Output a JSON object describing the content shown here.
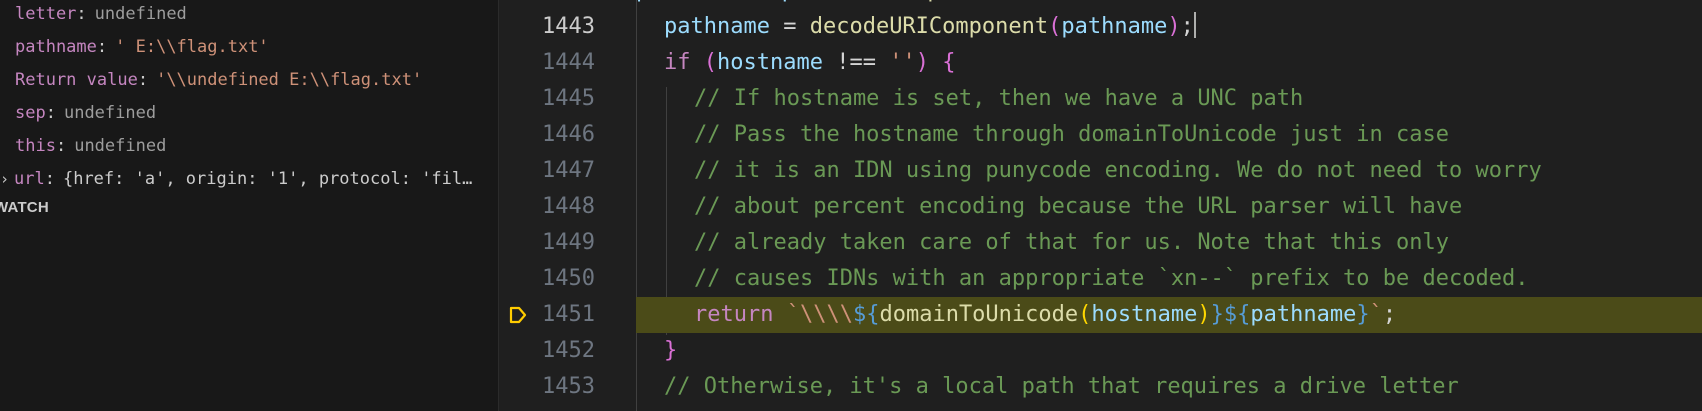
{
  "variables": [
    {
      "name": "letter",
      "value": "undefined",
      "kind": "undef"
    },
    {
      "name": "pathname",
      "value": "' E:\\\\flag.txt'",
      "kind": "str"
    },
    {
      "name": "Return value",
      "value": "'\\\\undefined E:\\\\flag.txt'",
      "kind": "str"
    },
    {
      "name": "sep",
      "value": "undefined",
      "kind": "undef"
    },
    {
      "name": "this",
      "value": "undefined",
      "kind": "undef"
    },
    {
      "name": "url",
      "value": "{href: 'a', origin: '1', protocol: 'fil…",
      "kind": "obj"
    }
  ],
  "watch_header": "WATCH",
  "editor": {
    "lines": [
      {
        "number": "1443",
        "code": "pathname = decodeURIComponent(pathname);",
        "kind": "cursor"
      },
      {
        "number": "1444",
        "code": "if (hostname !== '') {",
        "kind": "if"
      },
      {
        "number": "1445",
        "code": "// If hostname is set, then we have a UNC path",
        "kind": "comment"
      },
      {
        "number": "1446",
        "code": "// Pass the hostname through domainToUnicode just in case",
        "kind": "comment"
      },
      {
        "number": "1447",
        "code": "// it is an IDN using punycode encoding. We do not need to worry",
        "kind": "comment"
      },
      {
        "number": "1448",
        "code": "// about percent encoding because the URL parser will have",
        "kind": "comment"
      },
      {
        "number": "1449",
        "code": "// already taken care of that for us. Note that this only",
        "kind": "comment"
      },
      {
        "number": "1450",
        "code": "// causes IDNs with an appropriate `xn--` prefix to be decoded.",
        "kind": "comment"
      },
      {
        "number": "1451",
        "code": "return `\\\\\\\\${domainToUnicode(hostname)}${pathname}`;",
        "kind": "return"
      },
      {
        "number": "1452",
        "code": "}",
        "kind": "close"
      },
      {
        "number": "1453",
        "code": "// Otherwise, it's a local path that requires a drive letter",
        "kind": "comment"
      }
    ]
  },
  "colors": {
    "sidebar_bg": "#181818",
    "editor_bg": "#1f1f1f",
    "current_line_highlight": "#4b4b18",
    "debug_arrow": "#ffcc00"
  },
  "icons": {
    "debug_stop": "debug-stackframe-arrow-icon",
    "expand": "chevron-right-icon"
  }
}
